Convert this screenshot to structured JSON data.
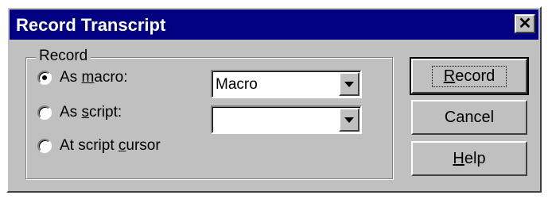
{
  "window": {
    "title": "Record Transcript",
    "close_label": "✕"
  },
  "group": {
    "label": "Record"
  },
  "options": [
    {
      "label_pre": "As ",
      "label_u": "m",
      "label_post": "acro:",
      "checked": true
    },
    {
      "label_pre": "As ",
      "label_u": "s",
      "label_post": "cript:",
      "checked": false
    },
    {
      "label_pre": "At script ",
      "label_u": "c",
      "label_post": "ursor",
      "checked": false
    }
  ],
  "macro_combo": {
    "value": "Macro"
  },
  "script_combo": {
    "value": ""
  },
  "buttons": {
    "record": {
      "label_u": "R",
      "label_post": "ecord"
    },
    "cancel": {
      "label": "Cancel"
    },
    "help": {
      "label_u": "H",
      "label_post": "elp"
    }
  }
}
